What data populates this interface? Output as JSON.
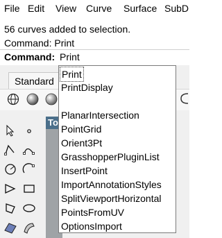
{
  "menubar": {
    "items": [
      "File",
      "Edit",
      "View",
      "Curve",
      "Surface",
      "SubD"
    ]
  },
  "history": {
    "lines": [
      "56 curves added to selection.",
      "Command: Print"
    ]
  },
  "command": {
    "label": "Command:",
    "value": "Print"
  },
  "toolbar": {
    "tab_label": "Standard"
  },
  "viewport": {
    "tab_label": "To"
  },
  "autocomplete": {
    "items": [
      "Print",
      "PrintDisplay",
      "",
      "PlanarIntersection",
      "PointGrid",
      "Orient3Pt",
      "GrasshopperPluginList",
      "InsertPoint",
      "ImportAnnotationStyles",
      "SplitViewportHorizontal",
      "PointsFromUV",
      "OptionsImport"
    ],
    "selected": "Print"
  },
  "colors": {
    "panel_bg": "#f0f0f0",
    "viewport_bg": "#9fa3a6",
    "viewport_tab_bg": "#4b6f8a"
  },
  "icons": {
    "toolbar": [
      "globe-icon",
      "sphere-shaded-icon",
      "sphere-icon"
    ],
    "sidebar": [
      "arrow-select-icon",
      "point-icon",
      "polyline-icon",
      "curve-icon",
      "circle-icon",
      "arc-icon",
      "triangle-icon",
      "rectangle-icon",
      "polygon-icon",
      "ellipse-icon",
      "surface-icon",
      "extrude-icon"
    ]
  }
}
